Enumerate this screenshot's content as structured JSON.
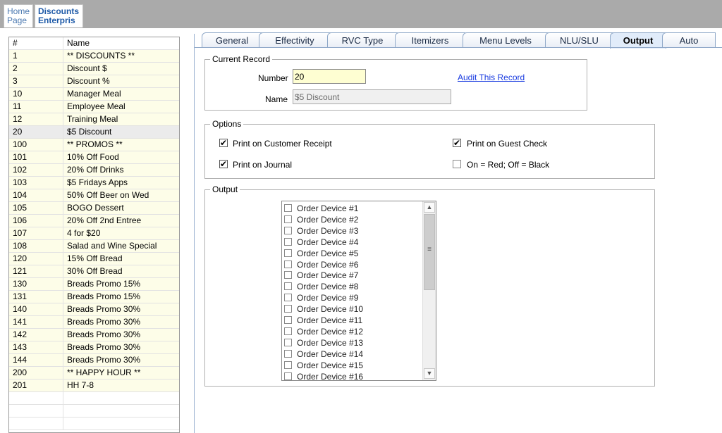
{
  "top_tabs": [
    {
      "line1": "Home",
      "line2": "Page"
    },
    {
      "line1": "Discounts",
      "line2": "Enterpris"
    }
  ],
  "list": {
    "columns": [
      "#",
      "Name"
    ],
    "rows": [
      {
        "num": "1",
        "name": "** DISCOUNTS **"
      },
      {
        "num": "2",
        "name": "Discount $"
      },
      {
        "num": "3",
        "name": "Discount %"
      },
      {
        "num": "10",
        "name": "Manager Meal"
      },
      {
        "num": "11",
        "name": "Employee Meal"
      },
      {
        "num": "12",
        "name": "Training Meal"
      },
      {
        "num": "20",
        "name": "$5 Discount"
      },
      {
        "num": "100",
        "name": "** PROMOS **"
      },
      {
        "num": "101",
        "name": "10% Off Food"
      },
      {
        "num": "102",
        "name": "20% Off Drinks"
      },
      {
        "num": "103",
        "name": "$5 Fridays Apps"
      },
      {
        "num": "104",
        "name": "50% Off Beer on Wed"
      },
      {
        "num": "105",
        "name": "BOGO Dessert"
      },
      {
        "num": "106",
        "name": "20% Off 2nd Entree"
      },
      {
        "num": "107",
        "name": "4 for $20"
      },
      {
        "num": "108",
        "name": "Salad and Wine Special"
      },
      {
        "num": "120",
        "name": "15% Off Bread"
      },
      {
        "num": "121",
        "name": "30% Off Bread"
      },
      {
        "num": "130",
        "name": "Breads Promo 15%"
      },
      {
        "num": "131",
        "name": "Breads Promo 15%"
      },
      {
        "num": "140",
        "name": "Breads Promo 30%"
      },
      {
        "num": "141",
        "name": "Breads Promo 30%"
      },
      {
        "num": "142",
        "name": "Breads Promo 30%"
      },
      {
        "num": "143",
        "name": "Breads Promo 30%"
      },
      {
        "num": "144",
        "name": "Breads Promo 30%"
      },
      {
        "num": "200",
        "name": "** HAPPY HOUR **"
      },
      {
        "num": "201",
        "name": "HH 7-8"
      }
    ],
    "selected_num": "20"
  },
  "property_tabs": [
    "General",
    "Effectivity",
    "RVC Type",
    "Itemizers",
    "Menu Levels",
    "NLU/SLU",
    "Output",
    "Auto"
  ],
  "active_tab": "Output",
  "current_record": {
    "legend": "Current Record",
    "number_label": "Number",
    "number_value": "20",
    "name_label": "Name",
    "name_value": "$5 Discount",
    "audit_link": "Audit This Record"
  },
  "options": {
    "legend": "Options",
    "print_customer_receipt": {
      "label": "Print on Customer Receipt",
      "checked": true
    },
    "print_journal": {
      "label": "Print on Journal",
      "checked": true
    },
    "print_guest_check": {
      "label": "Print on Guest Check",
      "checked": true
    },
    "on_red_off_black": {
      "label": "On = Red; Off = Black",
      "checked": false
    }
  },
  "output": {
    "legend": "Output",
    "devices": [
      "Order Device #1",
      "Order Device #2",
      "Order Device #3",
      "Order Device #4",
      "Order Device #5",
      "Order Device #6",
      "Order Device #7",
      "Order Device #8",
      "Order Device #9",
      "Order Device #10",
      "Order Device #11",
      "Order Device #12",
      "Order Device #13",
      "Order Device #14",
      "Order Device #15",
      "Order Device #16"
    ]
  },
  "icons": {
    "check_mark": "✔",
    "scroll_up": "▲",
    "scroll_down": "▼",
    "scroll_grip": "≡"
  }
}
